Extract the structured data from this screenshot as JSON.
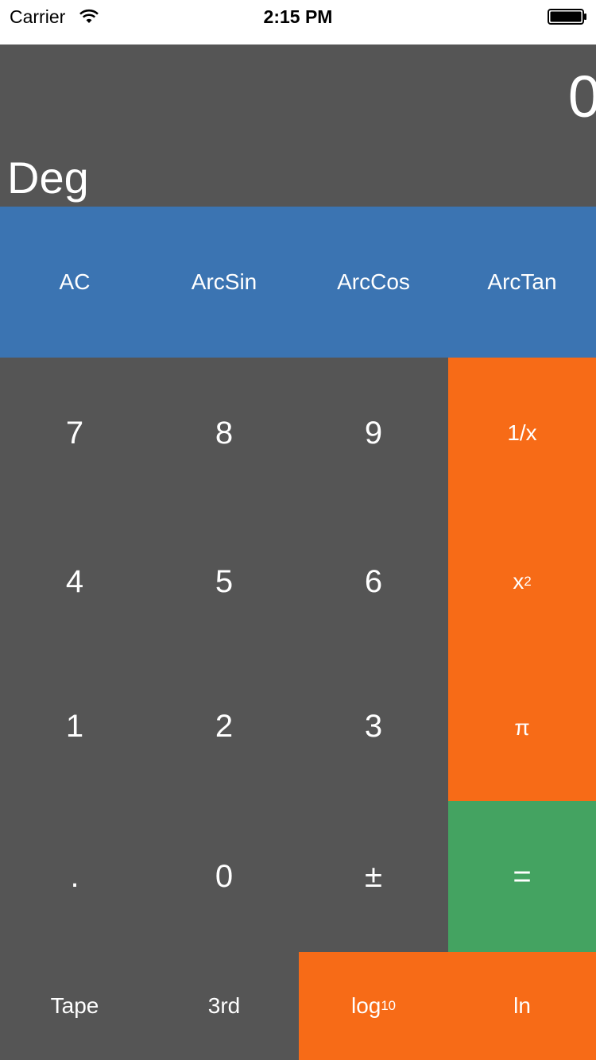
{
  "status_bar": {
    "carrier": "Carrier",
    "time": "2:15 PM",
    "wifi_icon": "wifi-icon",
    "battery_icon": "battery-icon"
  },
  "display": {
    "value": "0",
    "angle_mode": "Deg"
  },
  "function_row": {
    "keys": [
      "AC",
      "ArcSin",
      "ArcCos",
      "ArcTan"
    ]
  },
  "keypad": {
    "row1": [
      "7",
      "8",
      "9"
    ],
    "row2": [
      "4",
      "5",
      "6"
    ],
    "row3": [
      "1",
      "2",
      "3"
    ],
    "row4": [
      ".",
      "0",
      "±"
    ]
  },
  "operators": {
    "reciprocal": "1/x",
    "square_base": "x",
    "square_exp": "2",
    "pi": "π",
    "equals": "="
  },
  "bottom_row": {
    "tape": "Tape",
    "third": "3rd",
    "log_base": "log",
    "log_sub": "10",
    "ln": "ln"
  },
  "colors": {
    "display_bg": "#555555",
    "function_row_bg": "#3b74b2",
    "operator_orange": "#f76b17",
    "equals_green": "#44a361",
    "text": "#ffffff"
  }
}
